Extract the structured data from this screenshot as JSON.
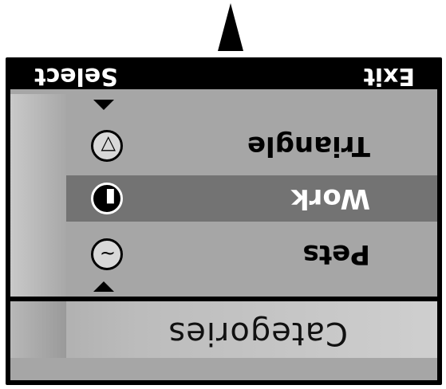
{
  "header": {
    "title": "Categories"
  },
  "list": {
    "items": [
      {
        "label": "Pets",
        "icon": "pets-icon",
        "selected": false
      },
      {
        "label": "Work",
        "icon": "work-icon",
        "selected": true
      },
      {
        "label": "Triangle",
        "icon": "triangle-icon",
        "selected": false
      }
    ]
  },
  "softkeys": {
    "left_label": "Select",
    "right_label": "Exit"
  },
  "colors": {
    "highlight": "#737373",
    "screen": "#a6a6a6",
    "frame": "#000000"
  }
}
